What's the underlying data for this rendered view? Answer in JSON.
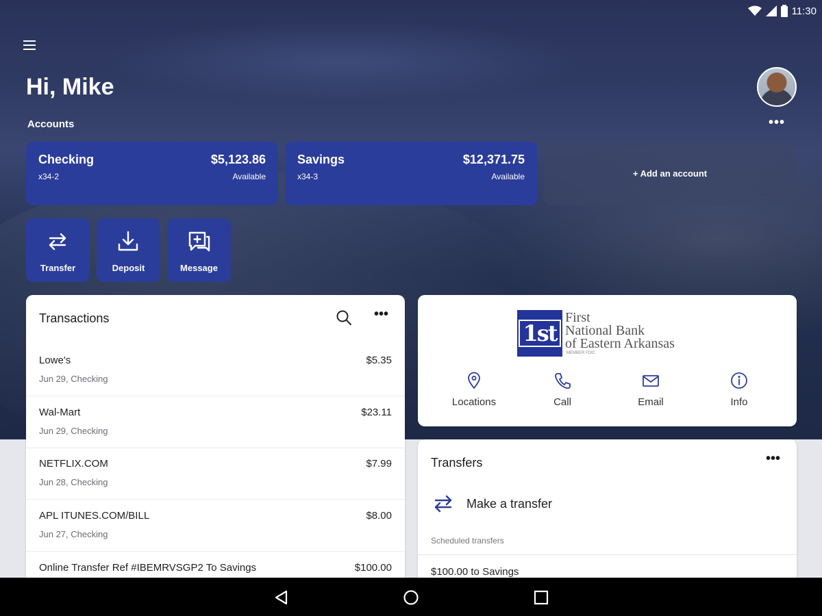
{
  "status_bar": {
    "time": "11:30"
  },
  "header": {
    "greeting": "Hi, Mike",
    "accounts_label": "Accounts"
  },
  "accounts": [
    {
      "name": "Checking",
      "number": "x34-2",
      "balance": "$5,123.86",
      "balance_label": "Available"
    },
    {
      "name": "Savings",
      "number": "x34-3",
      "balance": "$12,371.75",
      "balance_label": "Available"
    }
  ],
  "add_account_label": "+ Add an account",
  "actions": [
    {
      "label": "Transfer",
      "icon": "transfer-icon"
    },
    {
      "label": "Deposit",
      "icon": "deposit-icon"
    },
    {
      "label": "Message",
      "icon": "message-icon"
    }
  ],
  "transactions": {
    "title": "Transactions",
    "rows": [
      {
        "description": "Lowe's",
        "sub": "Jun 29, Checking",
        "amount": "$5.35"
      },
      {
        "description": "Wal-Mart",
        "sub": "Jun 29, Checking",
        "amount": "$23.11"
      },
      {
        "description": "NETFLIX.COM",
        "sub": "Jun 28, Checking",
        "amount": "$7.99"
      },
      {
        "description": "APL ITUNES.COM/BILL",
        "sub": "Jun 27, Checking",
        "amount": "$8.00"
      },
      {
        "description": "Online Transfer Ref #IBEMRVSGP2 To Savings",
        "sub": "",
        "amount": "$100.00"
      }
    ]
  },
  "bank": {
    "logo_mark": "1st",
    "name_lines": [
      "First",
      "National Bank",
      "of Eastern Arkansas"
    ],
    "fdic": "MEMBER FDIC",
    "brand_color": "#23349a",
    "contacts": [
      {
        "label": "Locations",
        "icon": "location-pin-icon"
      },
      {
        "label": "Call",
        "icon": "phone-icon"
      },
      {
        "label": "Email",
        "icon": "envelope-icon"
      },
      {
        "label": "Info",
        "icon": "info-icon"
      }
    ]
  },
  "transfers": {
    "title": "Transfers",
    "make_transfer_label": "Make a transfer",
    "scheduled_label": "Scheduled transfers",
    "scheduled_items": [
      "$100.00 to Savings"
    ]
  },
  "colors": {
    "accent": "#2b3d9a",
    "hero_bg": "#2a3259",
    "nav_bar": "#000000"
  }
}
